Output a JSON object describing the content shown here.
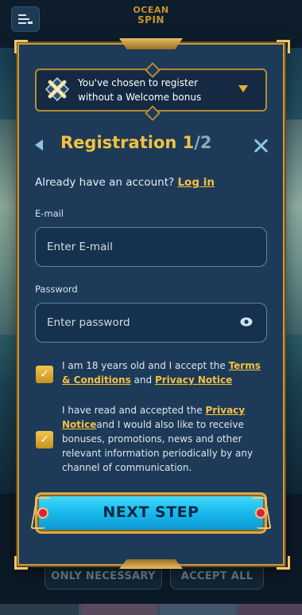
{
  "header": {
    "logo_line1": "OCEAN",
    "logo_line2": "SPIN",
    "menu_icon": "menu-lines-icon"
  },
  "bonus_banner": {
    "icon": "crossed-swords-badge-icon",
    "text": "You've chosen to register without a Welcome bonus",
    "chevron_icon": "chevron-down-icon"
  },
  "registration": {
    "title_prefix": "Registration 1",
    "title_total": "/2",
    "account_prompt": "Already have an account?",
    "login_link": "Log in",
    "email_label": "E-mail",
    "email_placeholder": "Enter E-mail",
    "email_value": "",
    "password_label": "Password",
    "password_placeholder": "Enter password",
    "password_value": "",
    "consent1": {
      "checked": true,
      "text_before": "I am 18 years old and I accept the",
      "terms_link": "Terms & Conditions",
      "and_text": "and",
      "privacy_link": "Privacy Notice"
    },
    "consent2": {
      "checked": true,
      "text_before": "I have read and accepted the",
      "privacy_link": "Privacy Notice",
      "text_after": "and I would also like to receive bonuses, promotions, news and other relevant information periodically by any channel of communication."
    },
    "next_button": "NEXT STEP"
  },
  "cookie_bar": {
    "only_necessary": "ONLY NECESSARY",
    "accept_all": "ACCEPT ALL"
  },
  "colors": {
    "accent_gold": "#f4c240",
    "panel_bg": "#1d3a58",
    "button_cyan": "#18b8ec"
  }
}
